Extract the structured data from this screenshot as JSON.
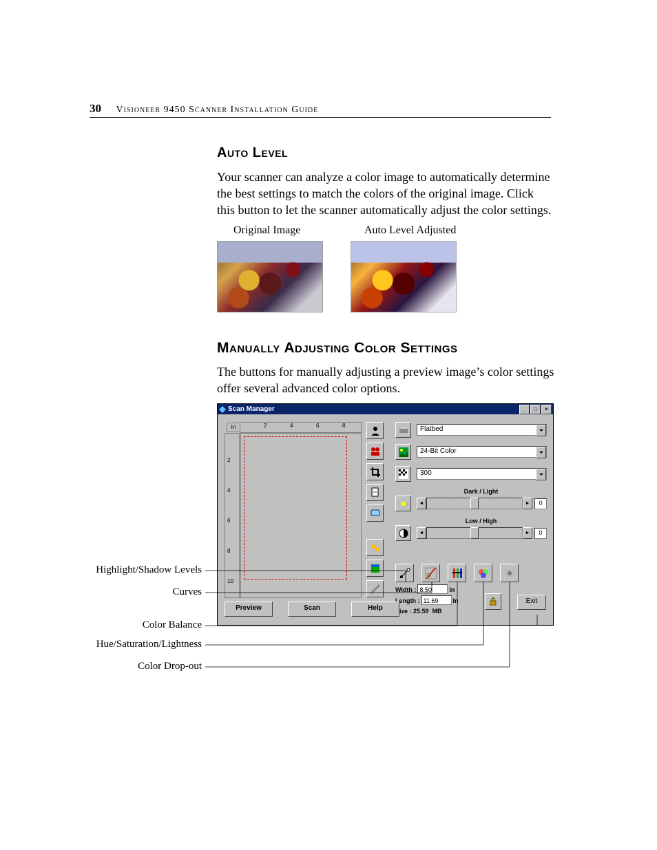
{
  "header": {
    "page_no": "30",
    "guide": "Visioneer 9450 Scanner Installation Guide"
  },
  "section_auto": {
    "title": "Auto Level",
    "para": "Your scanner can analyze a color image to automatically determine the best settings to match the colors of the original image. Click this button to let the scanner automatically adjust the color settings.",
    "caption_original": "Original Image",
    "caption_adjusted": "Auto Level Adjusted"
  },
  "section_manual": {
    "title": "Manually Adjusting Color Settings",
    "para": "The buttons for manually adjusting a preview image’s color settings offer several advanced color options."
  },
  "window": {
    "title": "Scan Manager",
    "ruler_unit": "In",
    "ruler_h": [
      "2",
      "4",
      "6",
      "8"
    ],
    "ruler_v": [
      "2",
      "4",
      "6",
      "8",
      "10"
    ],
    "toolbar": [
      "portrait",
      "duplex",
      "crop",
      "papersize",
      "rotate",
      "photo",
      "auto",
      "manual"
    ],
    "settings": {
      "scan_method": "Flatbed",
      "image_type": "24-Bit Color",
      "resolution": "300",
      "dark_light_label": "Dark / Light",
      "dark_light_value": "0",
      "low_high_label": "Low / High",
      "low_high_value": "0"
    },
    "color_tools": [
      "highlight-shadow",
      "curves",
      "color-balance",
      "hue-sat-light",
      "color-dropout"
    ],
    "dims": {
      "width_label": "Width :",
      "width_value": "8.50",
      "width_unit": "In",
      "length_label": "Length :",
      "length_value": "11.69",
      "length_unit": "In",
      "size_label": "Size : ",
      "size_value": "25.59",
      "size_unit": "MB"
    },
    "buttons": {
      "preview": "Preview",
      "scan": "Scan",
      "help": "Help",
      "exit": "Exit"
    }
  },
  "callouts": {
    "hs": "Highlight/Shadow Levels",
    "curves": "Curves",
    "balance": "Color Balance",
    "hsl": "Hue/Saturation/Lightness",
    "dropout": "Color Drop-out"
  }
}
